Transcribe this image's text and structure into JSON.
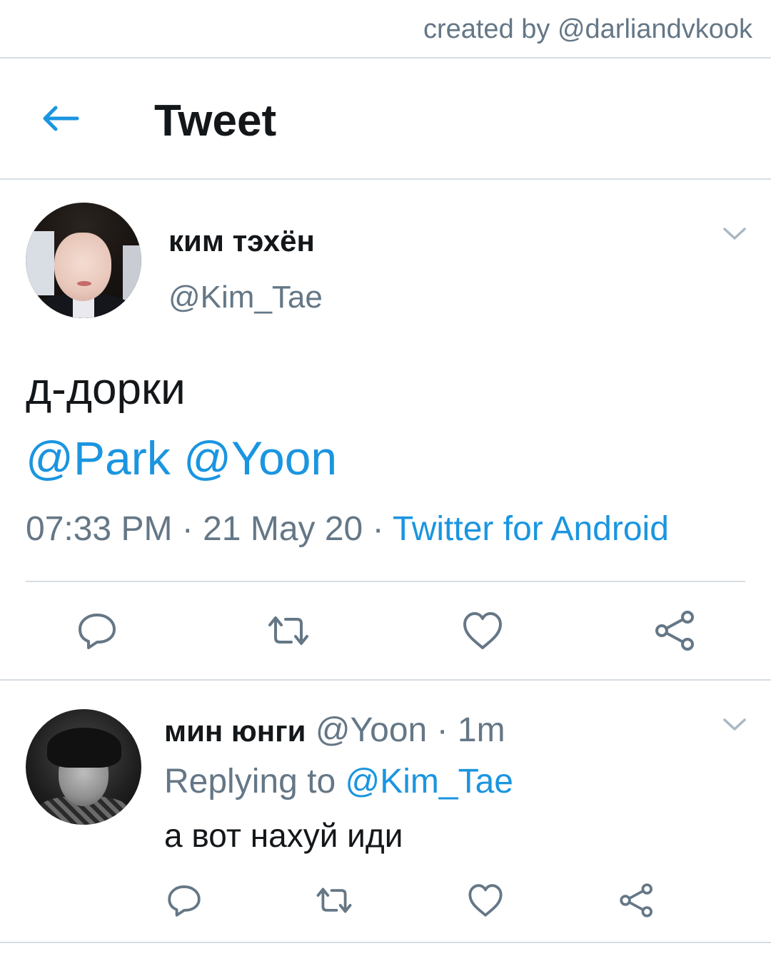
{
  "watermark": "created by @darliandvkook",
  "header": {
    "title": "Tweet",
    "back_icon": "arrow-left-icon"
  },
  "colors": {
    "accent": "#1b95e0",
    "secondary_text": "#657786",
    "divider": "#d6dde3"
  },
  "main_tweet": {
    "display_name": "ким тэхён",
    "handle": "@Kim_Tae",
    "text": "д-дорки",
    "mentions": [
      "@Park",
      "@Yoon"
    ],
    "time": "07:33 PM",
    "separator": " · ",
    "date": "21 May 20",
    "source": "Twitter for Android",
    "actions": [
      "reply-icon",
      "retweet-icon",
      "like-icon",
      "share-icon"
    ]
  },
  "reply": {
    "display_name": "мин юнги",
    "handle": "@Yoon",
    "separator": " · ",
    "age": "1m",
    "replying_prefix": "Replying to ",
    "replying_to": "@Kim_Tae",
    "text": "а вот нахуй иди",
    "actions": [
      "reply-icon",
      "retweet-icon",
      "like-icon",
      "share-icon"
    ]
  }
}
